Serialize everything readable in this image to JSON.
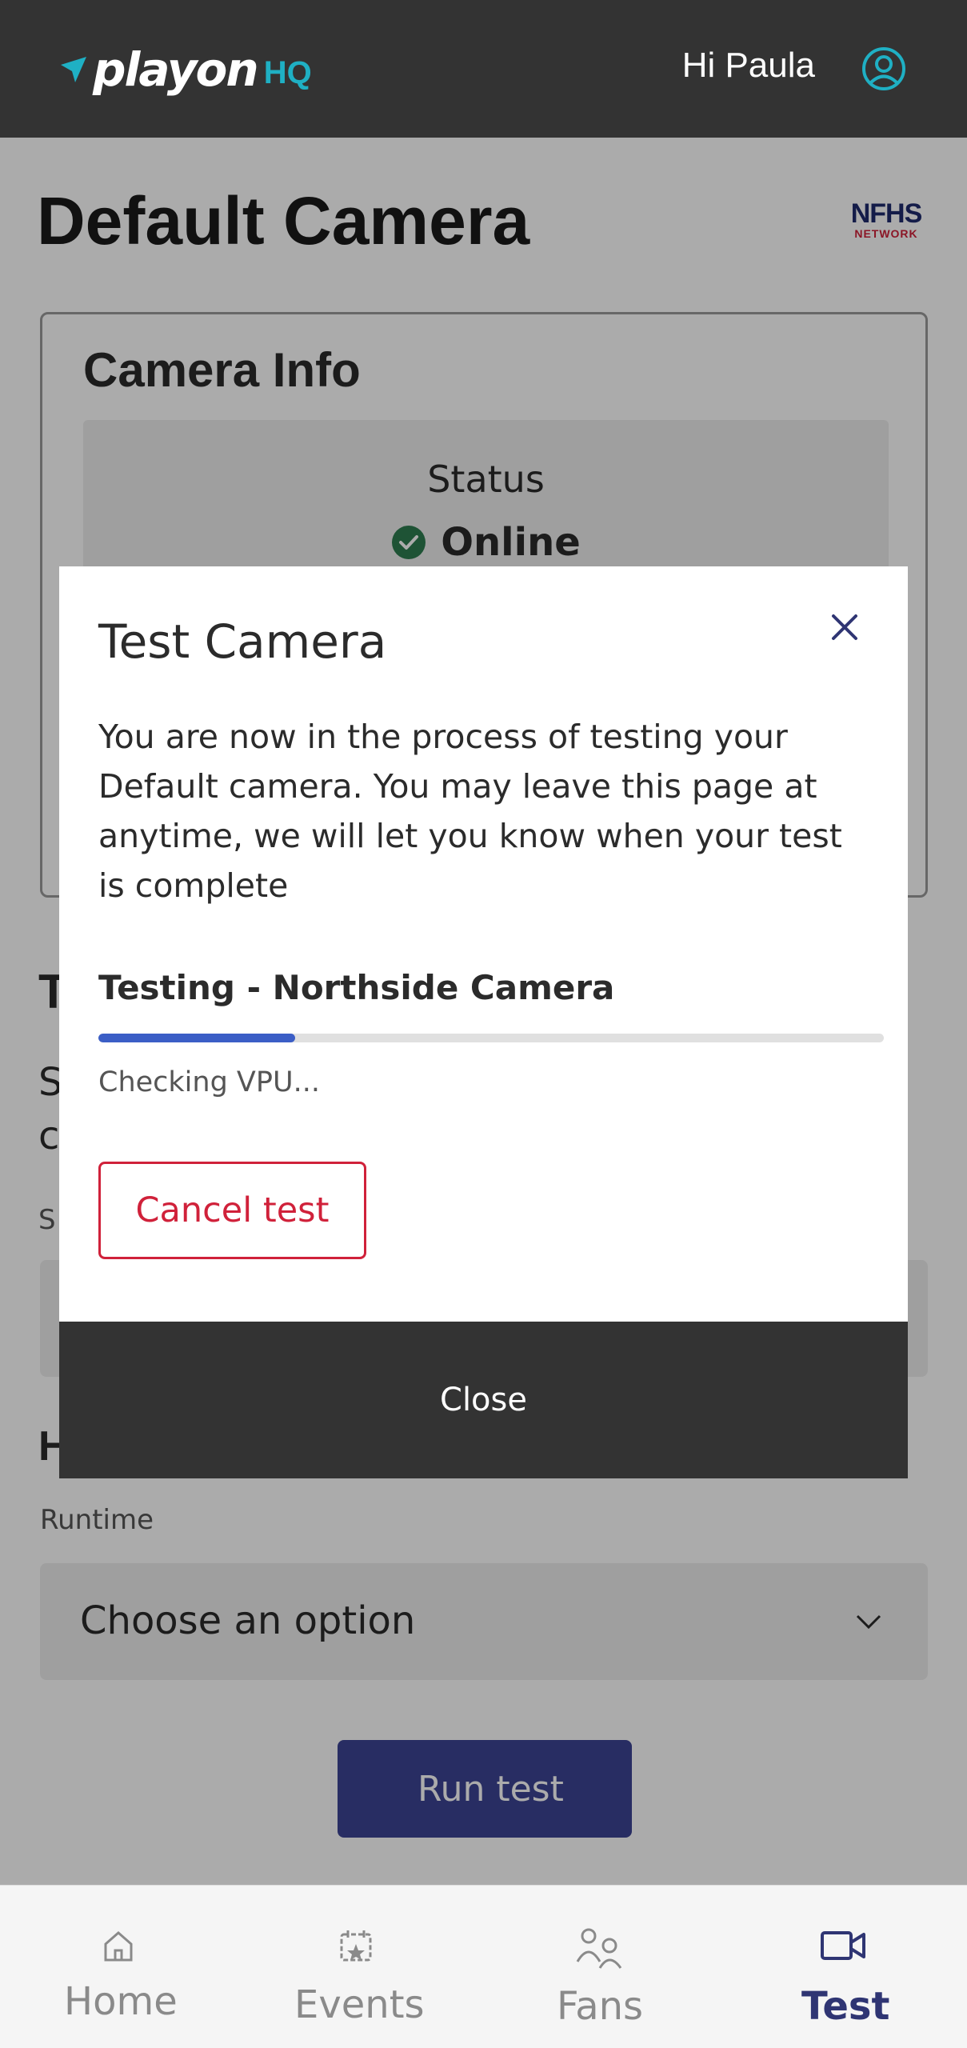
{
  "header": {
    "logo_text": "playon",
    "logo_suffix": "HQ",
    "greeting": "Hi Paula"
  },
  "page": {
    "title": "Default Camera",
    "partner_logo_top": "NFHS",
    "partner_logo_bottom": "NETWORK"
  },
  "camera_info": {
    "title": "Camera Info",
    "status_label": "Status",
    "status_value": "Online"
  },
  "background": {
    "heading_fragment": "T",
    "para_fragment_1": "S",
    "para_fragment_2": "c",
    "small_fragment": "S",
    "heading2_fragment": "H",
    "runtime_label": "Runtime",
    "runtime_placeholder": "Choose an option",
    "run_test_label": "Run test"
  },
  "modal": {
    "title": "Test Camera",
    "description": "You are now in the process of testing your Default camera. You may leave this page at anytime, we will let you know when your test is complete",
    "testing_label": "Testing - Northside Camera",
    "progress_percent": 25,
    "progress_status": "Checking VPU...",
    "cancel_label": "Cancel test",
    "close_label": "Close"
  },
  "nav": {
    "items": [
      {
        "label": "Home",
        "icon": "home-icon",
        "active": false
      },
      {
        "label": "Events",
        "icon": "calendar-star-icon",
        "active": false
      },
      {
        "label": "Fans",
        "icon": "people-icon",
        "active": false
      },
      {
        "label": "Test",
        "icon": "video-camera-icon",
        "active": true
      }
    ]
  },
  "colors": {
    "header_bg": "#333333",
    "brand_teal": "#1fb0c4",
    "primary": "#3c4394",
    "progress": "#3b5ec6",
    "danger": "#d0213a",
    "success": "#2e7d4f"
  }
}
